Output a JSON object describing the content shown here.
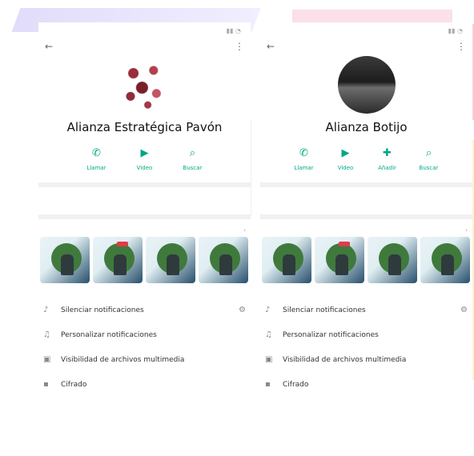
{
  "screens": [
    {
      "group_name": "Alianza Estratégica Pavón",
      "actions": [
        {
          "icon": "phone-icon",
          "label": "Llamar"
        },
        {
          "icon": "video-icon",
          "label": "Video"
        },
        {
          "icon": "search-icon",
          "label": "Buscar"
        }
      ],
      "menu": [
        {
          "label": "Silenciar notificaciones"
        },
        {
          "label": "Personalizar notificaciones"
        },
        {
          "label": "Visibilidad de archivos multimedia"
        },
        {
          "label": "Cifrado"
        }
      ]
    },
    {
      "group_name": "Alianza Botijo",
      "actions": [
        {
          "icon": "phone-icon",
          "label": "Llamar"
        },
        {
          "icon": "video-icon",
          "label": "Video"
        },
        {
          "icon": "add-participant-icon",
          "label": "Añadir"
        },
        {
          "icon": "search-icon",
          "label": "Buscar"
        }
      ],
      "menu": [
        {
          "label": "Silenciar notificaciones"
        },
        {
          "label": "Personalizar notificaciones"
        },
        {
          "label": "Visibilidad de archivos multimedia"
        },
        {
          "label": "Cifrado"
        }
      ]
    }
  ],
  "colors": {
    "accent": "#00a884"
  }
}
